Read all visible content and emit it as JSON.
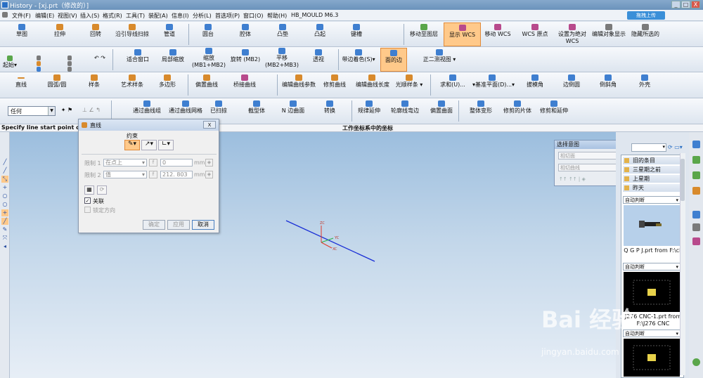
{
  "title_bar": {
    "title": "History - [xj.prt（修改的）]",
    "min": "_",
    "max": "□",
    "close": "X"
  },
  "menu": [
    "文件(F)",
    "编辑(E)",
    "视图(V)",
    "插入(S)",
    "格式(R)",
    "工具(T)",
    "装配(A)",
    "信息(I)",
    "分析(L)",
    "首选项(P)",
    "窗口(O)",
    "帮助(H)",
    "HB_MOULD M6.3"
  ],
  "menu_right": "拖拽上传",
  "toolbar_row1": [
    "草图",
    "拉伸",
    "回转",
    "沿引导线扫掠",
    "管道",
    "圆台",
    "腔体",
    "凸垫",
    "凸起",
    "键槽",
    "移动至图层",
    "显示 WCS",
    "移动 WCS",
    "WCS 原点",
    "设置为绝对 WCS",
    "编辑对象显示",
    "隐藏所选的"
  ],
  "toolbar_row2": {
    "start_label": "起始",
    "items": [
      "适合窗口",
      "局部缩放",
      "缩放 (MB1+MB2)",
      "旋转 (MB2)",
      "平移 (MB2+MB3)",
      "透视",
      "带边着色(S)",
      "面的边",
      "正二测视图"
    ]
  },
  "toolbar_row3": [
    "直线",
    "圆弧/圆",
    "样条",
    "艺术样条",
    "多边形",
    "偏置曲线",
    "桥接曲线",
    "编辑曲线参数",
    "修剪曲线",
    "编辑曲线长度",
    "光顺样条",
    "求和(U)...",
    "基准平面(D)...",
    "拔模角",
    "边倒圆",
    "倒斜角",
    "外壳"
  ],
  "toolbar_row4": {
    "filter_value": "任何",
    "items": [
      "通过曲线组",
      "通过曲线网格",
      "已扫掠",
      "截型体",
      "N 边曲面",
      "转换",
      "规律延伸",
      "轮廓线弯边",
      "偏置曲面",
      "整体变形",
      "修剪的片体",
      "修剪和延伸"
    ]
  },
  "status": {
    "cue": "Specify line start point or de",
    "coord": "工作坐标系中的坐标"
  },
  "dialog": {
    "title": "直线",
    "close": "X",
    "section": "约束",
    "limit1_label": "限制 1",
    "limit1_value": "在点上",
    "limit1_num": "0",
    "limit1_unit": "mm",
    "limit2_label": "限制 2",
    "limit2_value": "值",
    "limit2_num": "212. 803",
    "limit2_unit": "mm",
    "assoc_label": "关联",
    "lock_label": "锁定方向",
    "ok": "确定",
    "apply": "应用",
    "cancel": "取消"
  },
  "selection_panel": {
    "title": "选择意图",
    "field1": "相切面",
    "field2": "相切曲线"
  },
  "history": {
    "groups": [
      "旧的条目",
      "三星期之前",
      "上星期",
      "昨天"
    ],
    "filter": "自动判断",
    "items": [
      {
        "caption": "Q G P J.prt from F:\\ck"
      },
      {
        "caption": "J276 CNC-1.prt from F:\\J276 CNC"
      }
    ]
  },
  "viewport": {
    "axis_z": "ZC",
    "axis_x": "XC",
    "axis_y": "YC"
  },
  "watermark": {
    "main": "Bai 经验",
    "sub": "jingyan.baidu.com"
  },
  "colors": {
    "highlight": "#ffc98a",
    "line": "#1a2fd6",
    "viewport_top": "#9cbede"
  }
}
